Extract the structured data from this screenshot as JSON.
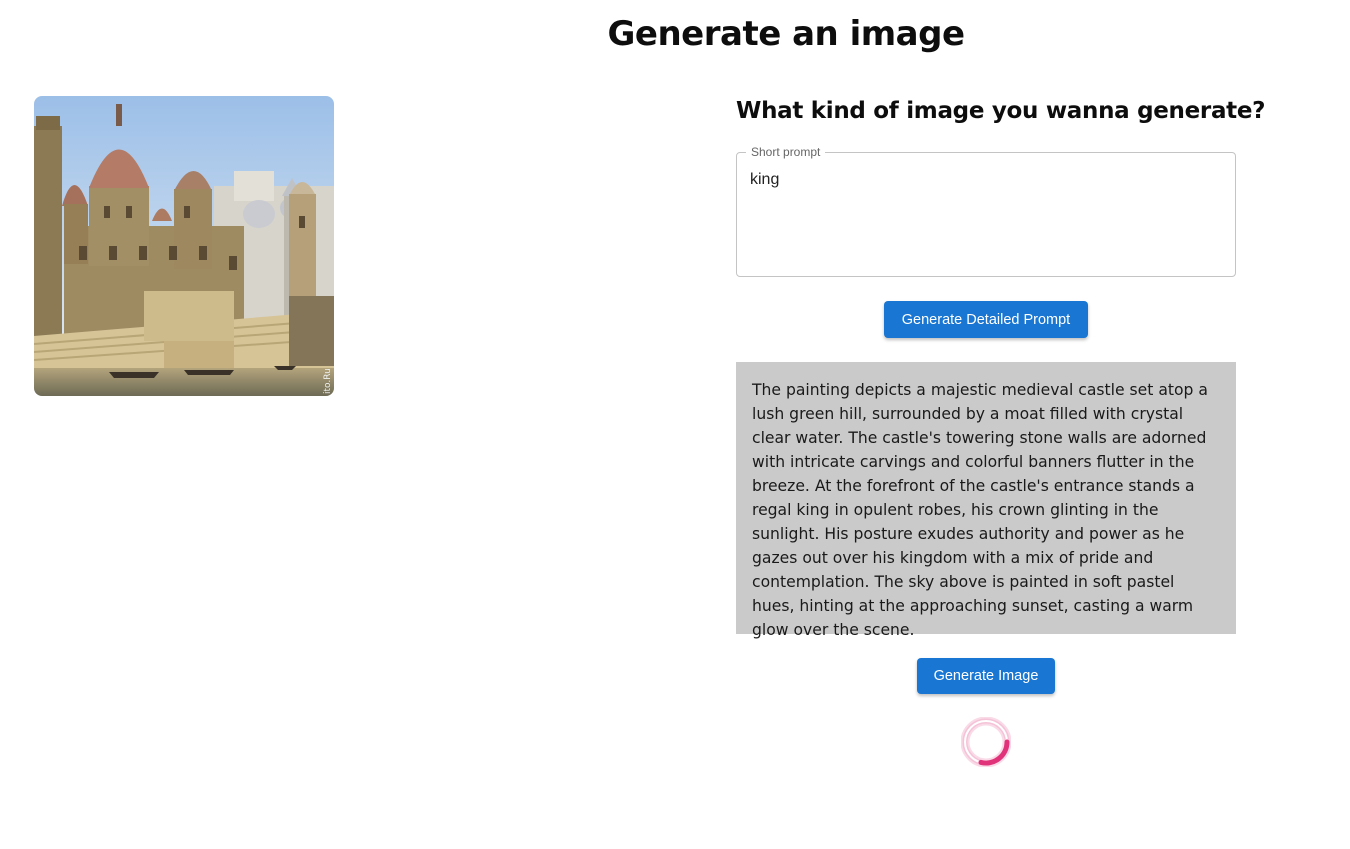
{
  "page": {
    "title": "Generate an image"
  },
  "preview": {
    "alt": "Painting of a palace with domes on stone steps beside a river",
    "watermark": "ito.Ru"
  },
  "form": {
    "heading": "What kind of image you wanna generate?",
    "short_prompt_label": "Short prompt",
    "short_prompt_value": "king",
    "generate_prompt_button": "Generate Detailed Prompt",
    "detailed_prompt": "The painting depicts a majestic medieval castle set atop a lush green hill, surrounded by a moat filled with crystal clear water. The castle's towering stone walls are adorned with intricate carvings and colorful banners flutter in the breeze. At the forefront of the castle's entrance stands a regal king in opulent robes, his crown glinting in the sunlight. His posture exudes authority and power as he gazes out over his kingdom with a mix of pride and contemplation. The sky above is painted in soft pastel hues, hinting at the approaching sunset, casting a warm glow over the scene.",
    "generate_image_button": "Generate Image"
  },
  "colors": {
    "primary": "#1976d2",
    "spinner": "#e0337a",
    "result_bg": "#cacaca"
  },
  "icons": {
    "loading": "loading-spinner-icon"
  }
}
